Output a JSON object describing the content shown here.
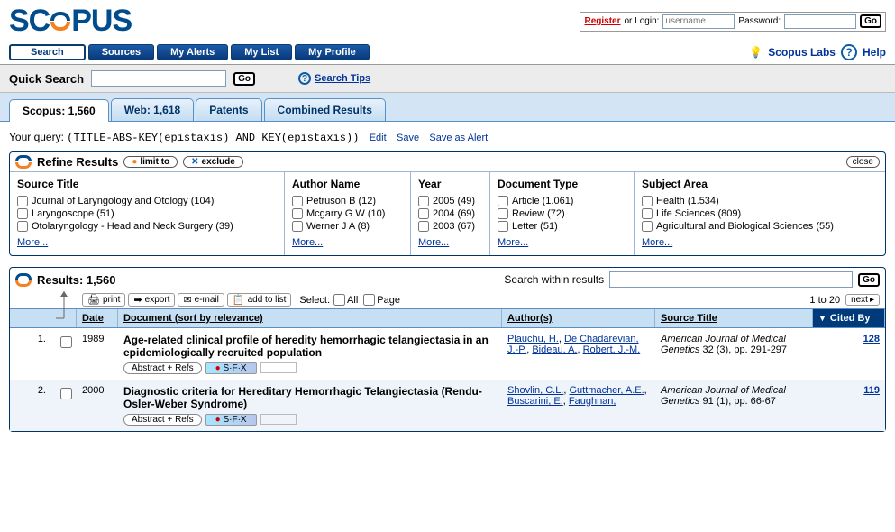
{
  "login": {
    "register": "Register",
    "or_login": "or Login:",
    "user_placeholder": "username",
    "pass_label": "Password:",
    "go": "Go"
  },
  "nav": {
    "search": "Search",
    "sources": "Sources",
    "alerts": "My Alerts",
    "list": "My List",
    "profile": "My Profile",
    "labs": "Scopus Labs",
    "help": "Help"
  },
  "quick": {
    "label": "Quick Search",
    "go": "Go",
    "tips": "Search Tips"
  },
  "tabs": {
    "scopus": "Scopus: 1,560",
    "web": "Web: 1,618",
    "patents": "Patents",
    "combined": "Combined Results"
  },
  "query": {
    "label": "Your query:",
    "text": "(TITLE-ABS-KEY(epistaxis) AND KEY(epistaxis))",
    "edit": "Edit",
    "save": "Save",
    "save_alert": "Save as Alert"
  },
  "refine": {
    "title": "Refine Results",
    "limit": "limit to",
    "exclude": "exclude",
    "close": "close",
    "more": "More...",
    "cols": [
      {
        "name": "Source Title",
        "items": [
          "Journal of Laryngology and Otology (104)",
          "Laryngoscope (51)",
          "Otolaryngology - Head and Neck Surgery (39)"
        ]
      },
      {
        "name": "Author Name",
        "items": [
          "Petruson B (12)",
          "Mcgarry G W (10)",
          "Werner J A (8)"
        ]
      },
      {
        "name": "Year",
        "items": [
          "2005 (49)",
          "2004 (69)",
          "2003 (67)"
        ]
      },
      {
        "name": "Document Type",
        "items": [
          "Article (1.061)",
          "Review (72)",
          "Letter (51)"
        ]
      },
      {
        "name": "Subject Area",
        "items": [
          "Health (1.534)",
          "Life Sciences (809)",
          "Agricultural and Biological Sciences (55)"
        ]
      }
    ]
  },
  "results": {
    "title_prefix": "Results:",
    "count": "1,560",
    "search_within": "Search within results",
    "go": "Go",
    "print": "print",
    "export": "export",
    "email": "e-mail",
    "add": "add to list",
    "select_label": "Select:",
    "all": "All",
    "page": "Page",
    "range": "1 to 20",
    "next": "next",
    "hdr": {
      "date": "Date",
      "doc": "Document (sort by relevance)",
      "auth": "Author(s)",
      "src": "Source Title",
      "cited": "Cited By"
    },
    "abstract_btn": "Abstract + Refs",
    "sfx": "S·F·X",
    "rows": [
      {
        "n": "1.",
        "date": "1989",
        "title": "Age-related clinical profile of heredity hemorrhagic telangiectasia in an epidemiologically recruited population",
        "authors": [
          "Plauchu, H.",
          "De Chadarevian, J.-P.",
          "Bideau, A.",
          "Robert, J.-M."
        ],
        "src_name": "American Journal of Medical Genetics",
        "src_rest": " 32 (3), pp. 291-297",
        "cited": "128"
      },
      {
        "n": "2.",
        "date": "2000",
        "title": "Diagnostic criteria for Hereditary Hemorrhagic Telangiectasia (Rendu- Osler-Weber Syndrome)",
        "authors": [
          "Shovlin, C.L.",
          "Guttmacher, A.E.",
          "Buscarini, E.",
          "Faughnan,"
        ],
        "src_name": "American Journal of Medical Genetics",
        "src_rest": " 91 (1), pp. 66-67",
        "cited": "119"
      }
    ]
  }
}
